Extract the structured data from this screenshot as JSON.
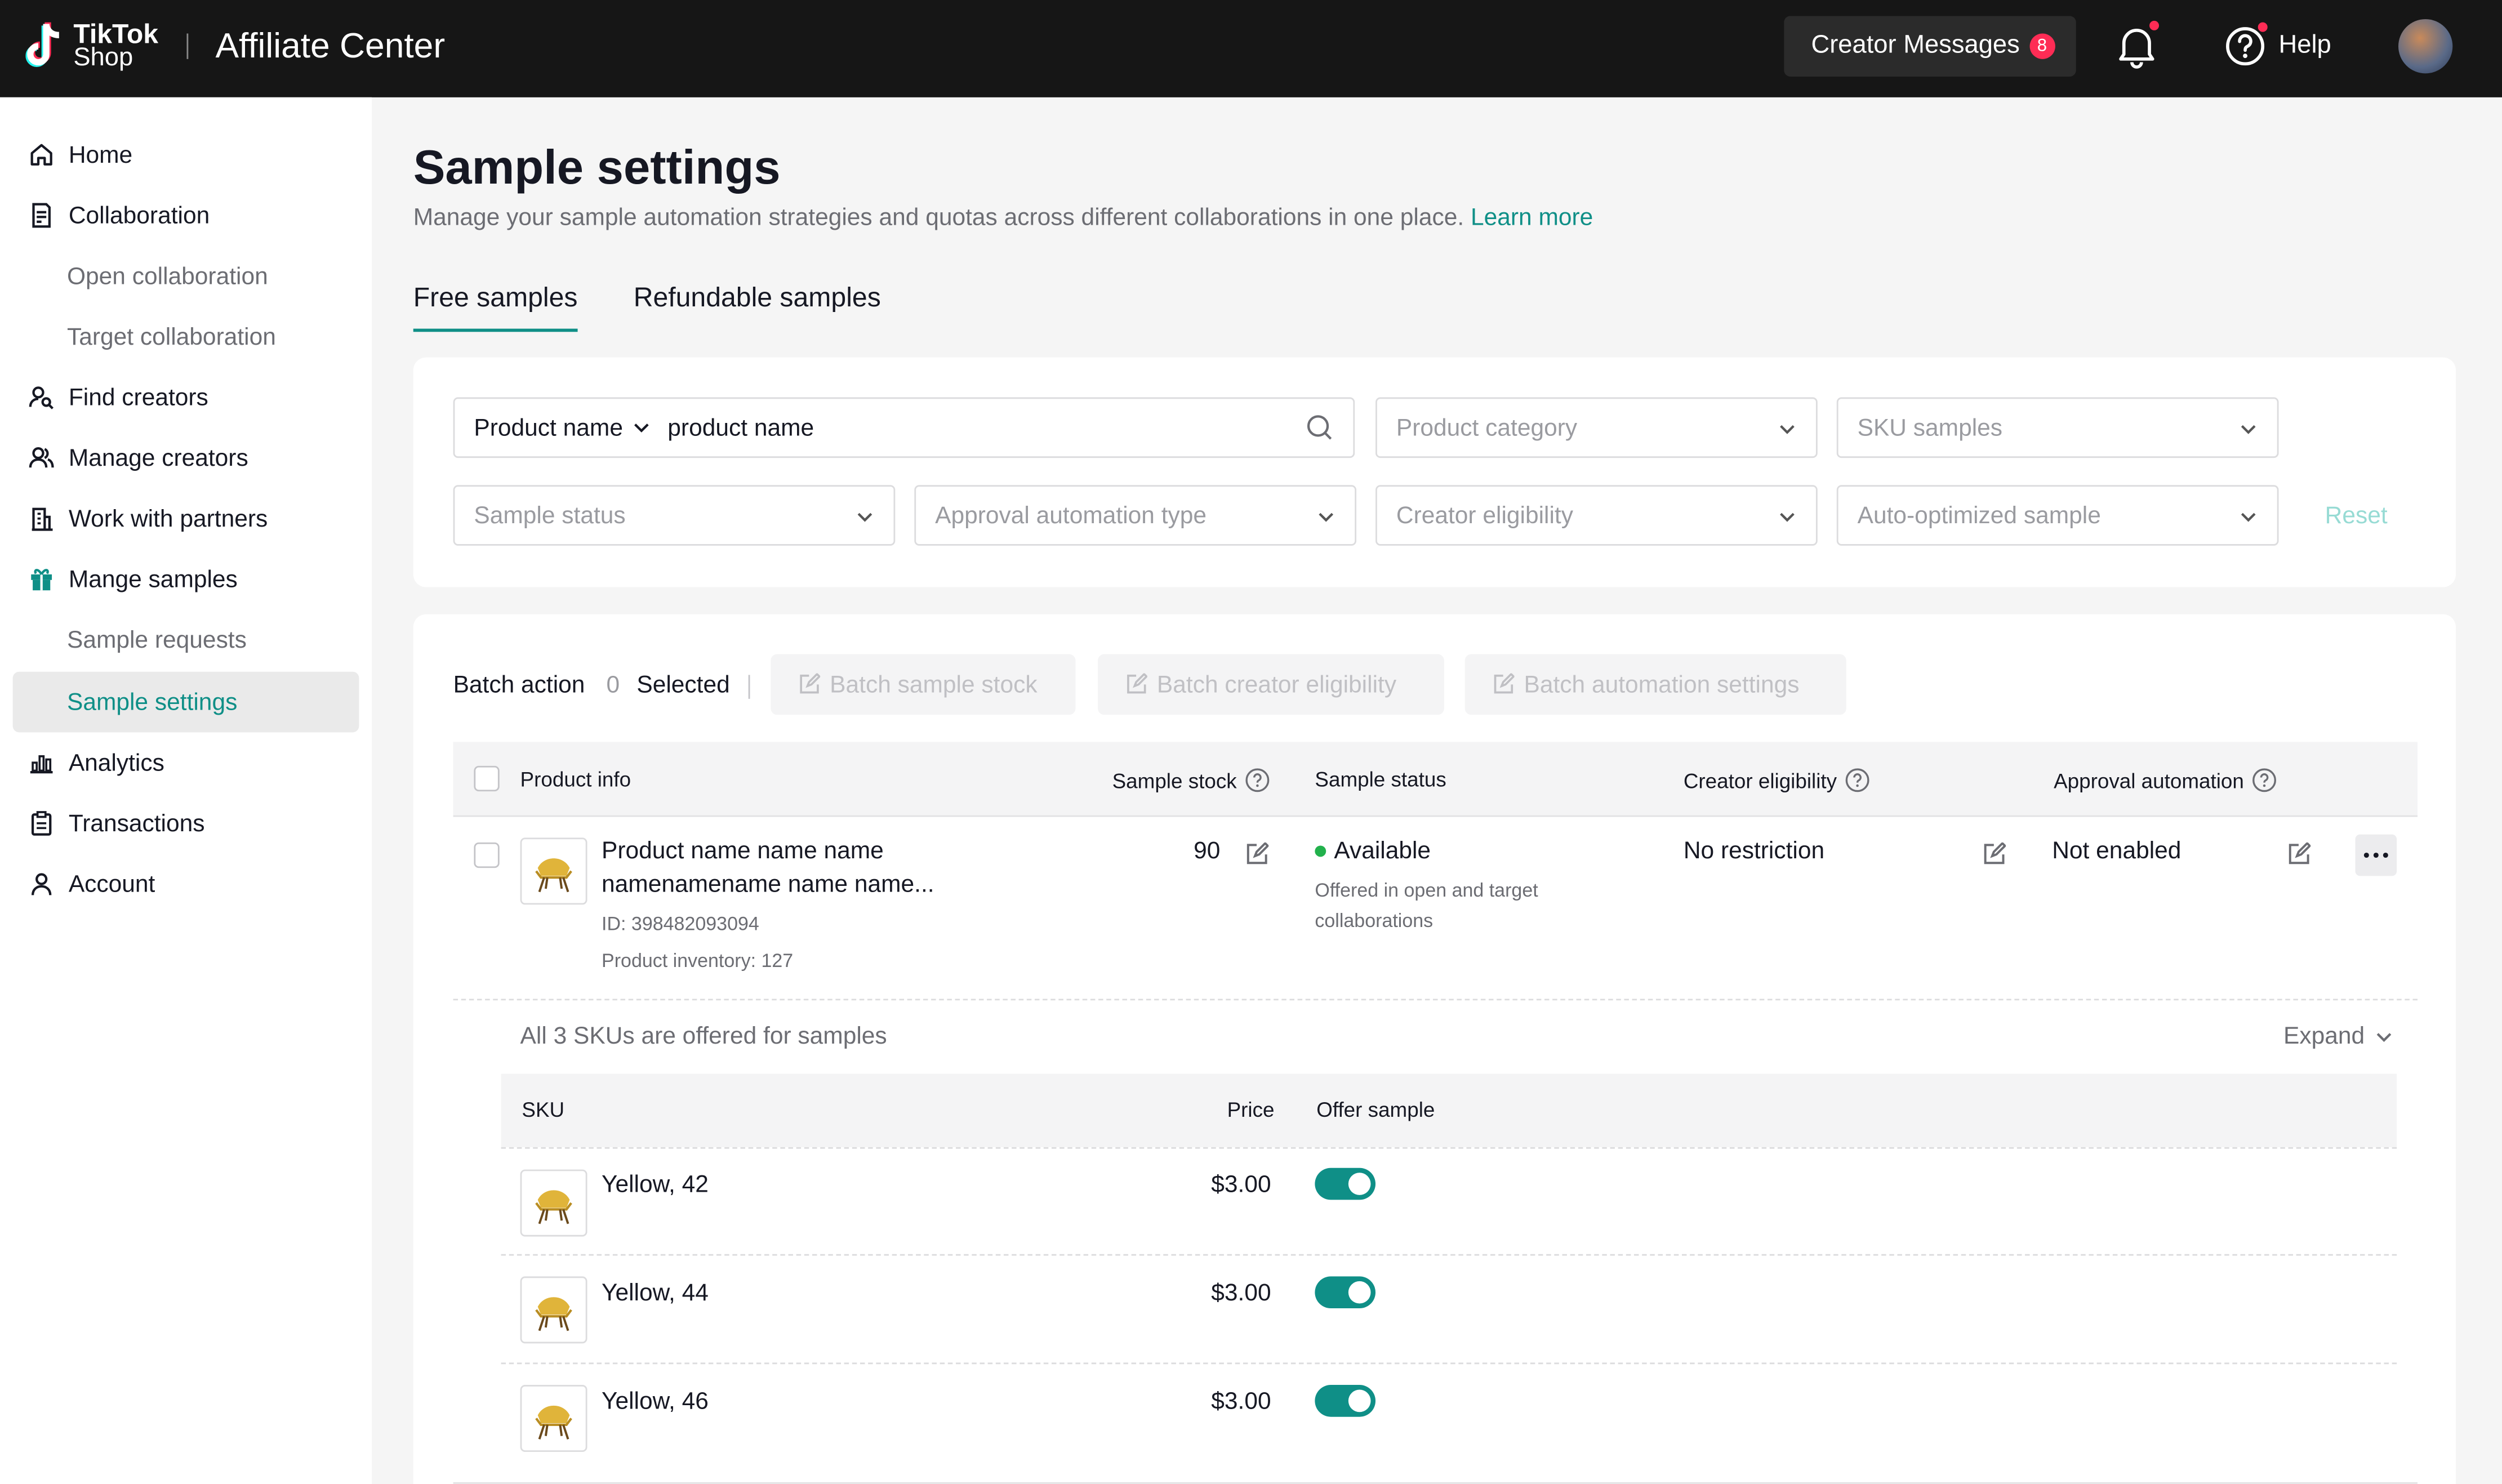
{
  "header": {
    "logo_line1": "TikTok",
    "logo_line2": "Shop",
    "app_title": "Affiliate Center",
    "messages_label": "Creator Messages",
    "messages_count": "8",
    "help_label": "Help"
  },
  "sidebar": {
    "items": [
      {
        "label": "Home",
        "icon": "home-icon"
      },
      {
        "label": "Collaboration",
        "icon": "document-icon"
      },
      {
        "label": "Open collaboration"
      },
      {
        "label": "Target collaboration"
      },
      {
        "label": "Find creators",
        "icon": "person-search-icon"
      },
      {
        "label": "Manage creators",
        "icon": "people-icon"
      },
      {
        "label": "Work with partners",
        "icon": "building-icon"
      },
      {
        "label": "Mange samples",
        "icon": "gift-icon"
      },
      {
        "label": "Sample requests"
      },
      {
        "label": "Sample settings",
        "active": true
      },
      {
        "label": "Analytics",
        "icon": "bar-chart-icon"
      },
      {
        "label": "Transactions",
        "icon": "clipboard-icon"
      },
      {
        "label": "Account",
        "icon": "user-icon"
      }
    ]
  },
  "page": {
    "title": "Sample settings",
    "description": "Manage your sample automation strategies and quotas across different collaborations in one place.",
    "learn_more": "Learn more",
    "tabs": [
      "Free samples",
      "Refundable samples"
    ]
  },
  "filters": {
    "search_type": "Product name",
    "search_value": "product name",
    "product_category": "Product category",
    "sku_samples": "SKU samples",
    "sample_status": "Sample status",
    "approval_automation_type": "Approval automation type",
    "creator_eligibility": "Creator eligibility",
    "auto_optimized_sample": "Auto-optimized sample",
    "reset": "Reset"
  },
  "batch": {
    "label": "Batch action",
    "selected_count": "0",
    "selected_label": "Selected",
    "buttons": [
      "Batch sample stock",
      "Batch creator eligibility",
      "Batch automation settings"
    ]
  },
  "table": {
    "columns": [
      "Product info",
      "Sample stock",
      "Sample status",
      "Creator eligibility",
      "Approval automation"
    ],
    "row": {
      "name_line1": "Product name name name",
      "name_line2": "namenamename name name...",
      "id": "ID: 398482093094",
      "inventory": "Product inventory: 127",
      "sample_stock": "90",
      "status": "Available",
      "status_note_1": "Offered in open and target",
      "status_note_2": "collaborations",
      "creator_eligibility": "No restriction",
      "approval_automation": "Not enabled"
    },
    "sku_summary": "All 3 SKUs are offered for samples",
    "expand_label": "Expand",
    "sku_columns": [
      "SKU",
      "Price",
      "Offer sample"
    ],
    "skus": [
      {
        "name": "Yellow, 42",
        "price": "$3.00",
        "offer_sample": true
      },
      {
        "name": "Yellow, 44",
        "price": "$3.00",
        "offer_sample": true
      },
      {
        "name": "Yellow, 46",
        "price": "$3.00",
        "offer_sample": true
      }
    ]
  },
  "colors": {
    "accent": "#0f8f87",
    "topbar": "#161616",
    "badge": "#fe2c55",
    "status_green": "#22b14c"
  }
}
